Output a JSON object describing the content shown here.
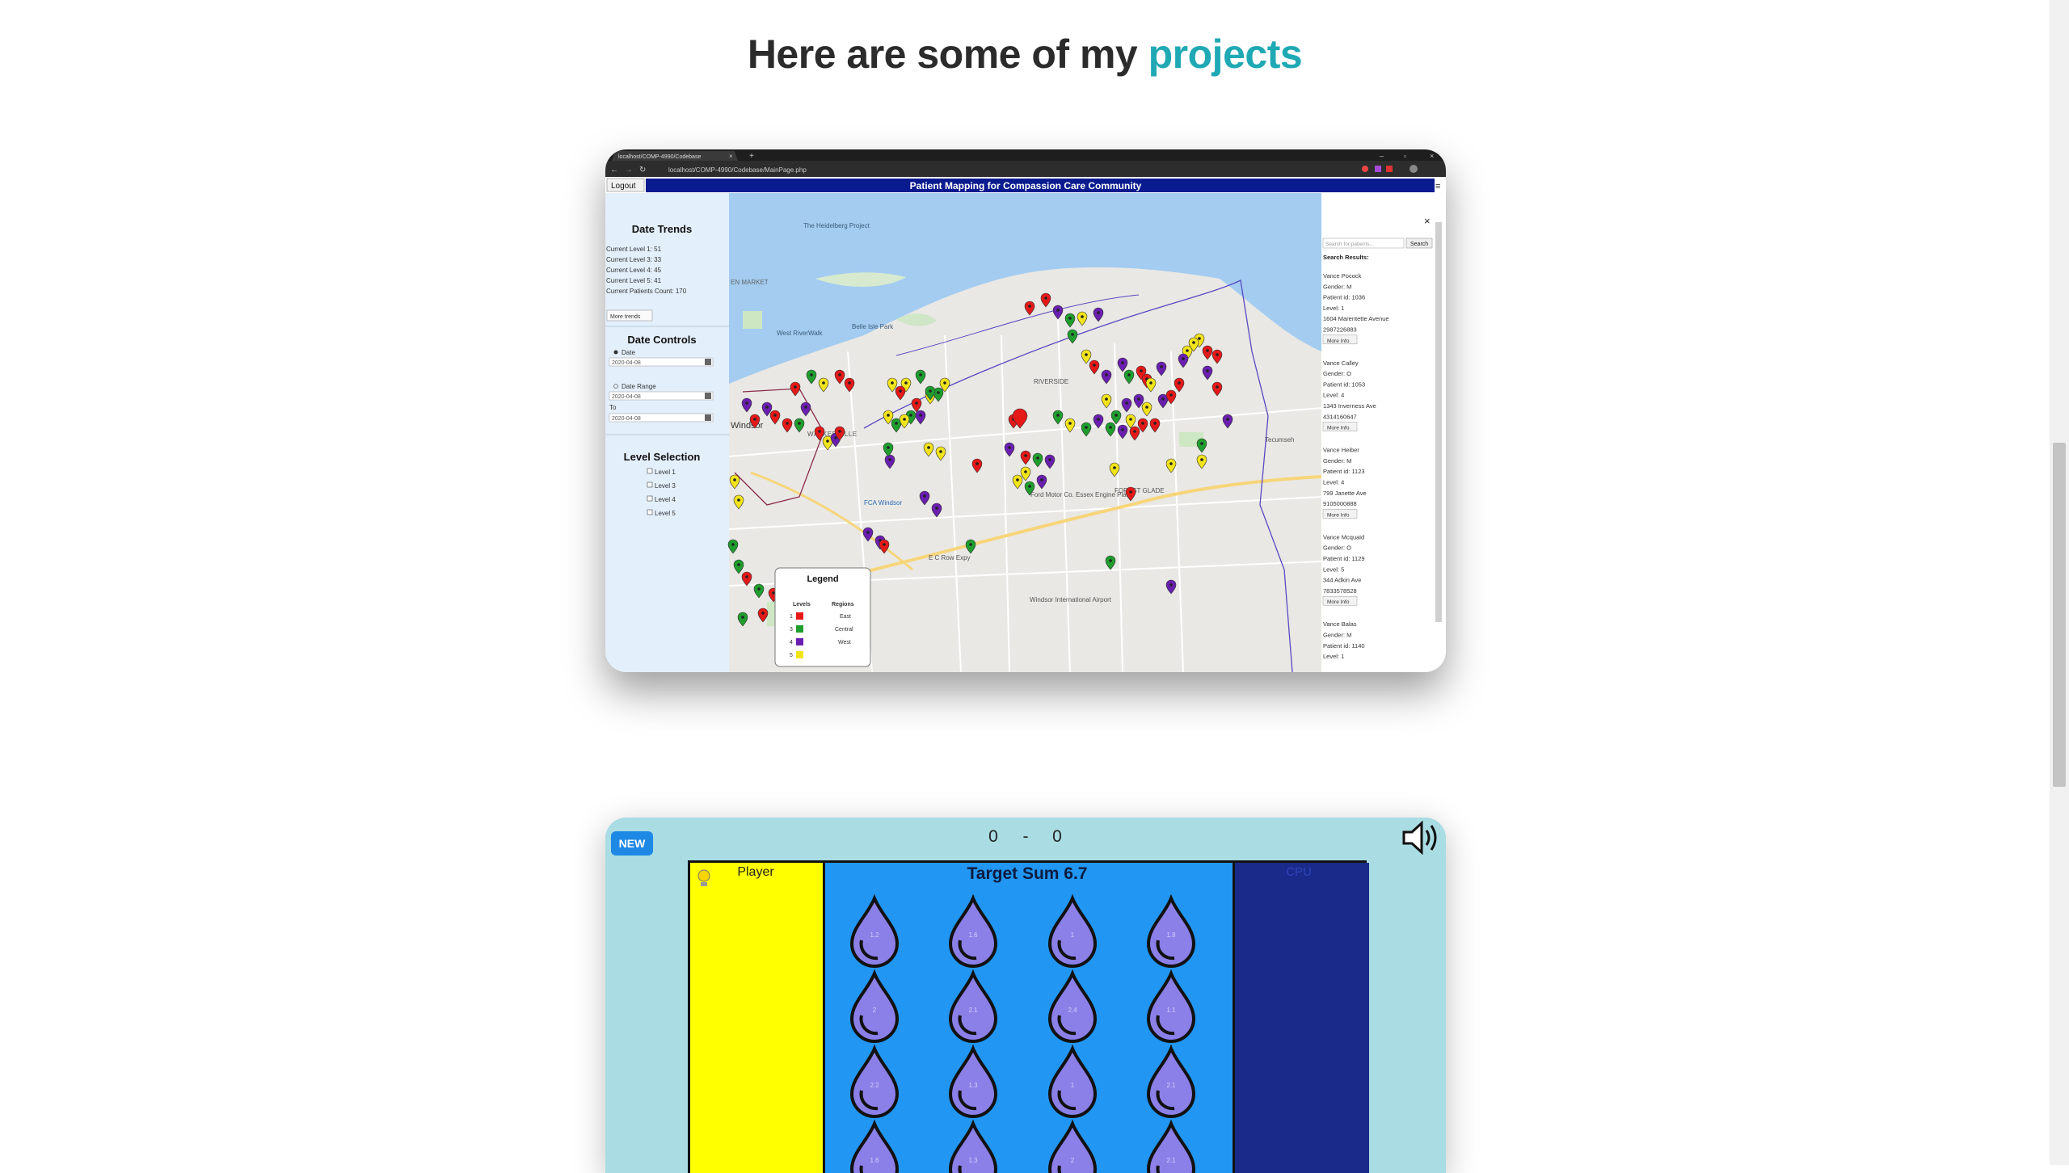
{
  "heading": {
    "prefix": "Here are some of my",
    "accent": "projects"
  },
  "colors": {
    "accent": "#1fa9b4",
    "heading": "#2b2b2b",
    "map_header": "#0a1a8f",
    "player_panel": "#ffff00",
    "board": "#2196f3",
    "cpu_panel": "#1a2a8a"
  },
  "project1": {
    "browser_tab": "localhost/COMP-4990/Codebase",
    "browser_url": "localhost/COMP-4990/Codebase/MainPage.php",
    "logout": "Logout",
    "app_title": "Patient Mapping for Compassion Care Community",
    "trends": {
      "title": "Date Trends",
      "lines": [
        "Current Level 1: 51",
        "Current Level 3: 33",
        "Current Level 4: 45",
        "Current Level 5: 41",
        "Current Patients Count: 170"
      ],
      "more_button": "More trends"
    },
    "controls": {
      "title": "Date Controls",
      "date_label": "Date",
      "date_value": "2020-04-08",
      "range_label": "Date Range",
      "range_from": "2020-04-08",
      "to_label": "To",
      "range_to": "2020-04-08"
    },
    "levels": {
      "title": "Level Selection",
      "items": [
        "Level 1",
        "Level 3",
        "Level 4",
        "Level 5"
      ]
    },
    "map_labels": {
      "heidelberg": "The Heidelberg Project",
      "belle_isle": "Belle Isle Park",
      "riverwalk": "West RiverWalk",
      "walkerville": "WALKERVILLE",
      "windsor": "Windsor",
      "riverside": "RIVERSIDE",
      "fca": "FCA Windsor",
      "ford": "Ford Motor Co. Essex Engine Plant",
      "forest_glade": "FOREST GLADE",
      "tecumseh": "Tecumseh",
      "airport": "Windsor International Airport",
      "ec_row": "E C Row Expy",
      "west_market": "EN MARKET"
    },
    "legend": {
      "title": "Legend",
      "levels_header": "Levels",
      "regions_header": "Regions",
      "levels": [
        "1",
        "3",
        "4",
        "5"
      ],
      "regions": [
        "East",
        "Central",
        "West"
      ]
    },
    "search": {
      "placeholder": "Search for patients...",
      "button": "Search",
      "results_label": "Search Results:",
      "more_info": "More Info",
      "results": [
        {
          "name": "Vance Pocock",
          "gender": "Gender: M",
          "patient_id": "Patient id: 1036",
          "level": "Level: 1",
          "address": "1604 Marentette Avenue",
          "phone": "2987226883"
        },
        {
          "name": "Vance Calley",
          "gender": "Gender: O",
          "patient_id": "Patient id: 1053",
          "level": "Level: 4",
          "address": "1343 Inverness Ave",
          "phone": "4314160647"
        },
        {
          "name": "Vance Heiber",
          "gender": "Gender: M",
          "patient_id": "Patient id: 1123",
          "level": "Level: 4",
          "address": "799 Janette Ave",
          "phone": "9105000888"
        },
        {
          "name": "Vance Mcquaid",
          "gender": "Gender: O",
          "patient_id": "Patient id: 1129",
          "level": "Level: 5",
          "address": "344 Adkin Ave",
          "phone": "7833578528"
        },
        {
          "name": "Vance Balas",
          "gender": "Gender: M",
          "patient_id": "Patient id: 1140",
          "level": "Level: 1"
        }
      ]
    }
  },
  "project2": {
    "badge": "NEW",
    "score_left": "0",
    "score_sep": "-",
    "score_right": "0",
    "player_label": "Player",
    "target": "Target Sum 6.7",
    "cpu_label": "CPU",
    "drops": [
      "1.2",
      "1.6",
      "1",
      "1.8",
      "2",
      "2.1",
      "2.4",
      "1.1",
      "2.2",
      "1.3",
      "1",
      "2.1",
      "1.6",
      "1.3",
      "2",
      "2.1"
    ]
  }
}
